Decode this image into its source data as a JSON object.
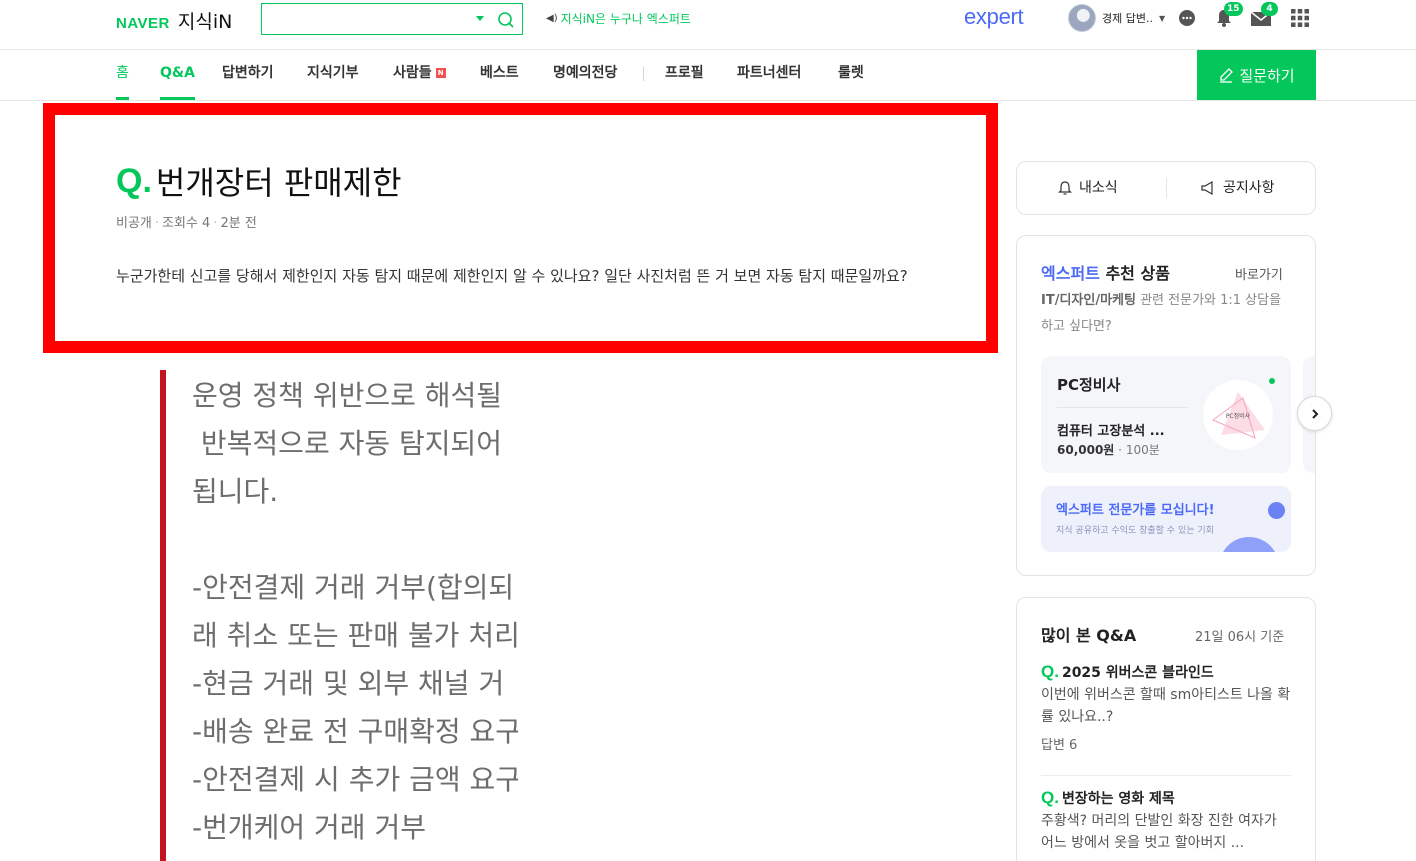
{
  "header": {
    "logo_naver": "NAVER",
    "logo_jisik": "지식iN",
    "search_value": "",
    "notice": "지식iN은 누구나 엑스퍼트",
    "expert_logo": "expert",
    "user_name": "경제 답변..",
    "notification_count": "15",
    "mail_count": "4"
  },
  "nav": {
    "items": [
      "홈",
      "Q&A",
      "답변하기",
      "지식기부",
      "사람들",
      "베스트",
      "명예의전당",
      "프로필",
      "파트너센터",
      "룰렛"
    ],
    "new_badge": "N",
    "ask_button": "질문하기"
  },
  "question": {
    "q_mark": "Q.",
    "title": "번개장터 판매제한",
    "author": "비공개",
    "views_label": "조회수 4",
    "time": "2분 전",
    "body": "누군가한테 신고를 당해서 제한인지 자동 탐지 때문에 제한인지 알 수 있나요? 일단 사진처럼 뜬 거 보면 자동 탐지 때문일까요?"
  },
  "attachment": {
    "lines": [
      "운영 정책 위반으로 해석될",
      " 반복적으로 자동 탐지되어",
      "됩니다.",
      "",
      "-안전결제 거래 거부(합의되",
      "래 취소 또는 판매 불가 처리",
      "-현금 거래 및 외부 채널 거",
      "-배송 완료 전 구매확정 요구",
      "-안전결제 시 추가 금액 요구",
      "-번개케어 거래 거부"
    ]
  },
  "sidebar": {
    "tab_news": "내소식",
    "tab_notice": "공지사항",
    "expert": {
      "head_blue": "엑스퍼트",
      "head_rest": " 추천 상품",
      "link": "바로가기",
      "sub_bold": "IT/디자인/마케팅",
      "sub_rest": " 관련 전문가와 1:1 상담을 하고 싶다면?",
      "product_title": "PC정비사",
      "product_name": "컴퓨터 고장분석 ...",
      "product_price": "60,000원",
      "product_time": "100분",
      "thumb_label": "PC정비사",
      "recruit_title": "엑스퍼트 전문가를 모십니다!",
      "recruit_sub": "지식 공유하고 수익도 창출할 수 있는 기회"
    },
    "popular": {
      "title": "많이 본 Q&A",
      "time": "21일 06시 기준",
      "items": [
        {
          "q": "2025 위버스콘 블라인드",
          "desc": "이번에 위버스콘 할때 sm아티스트 나올 확률 있나요..?",
          "answers": "답변 6"
        },
        {
          "q": "변장하는 영화 제목",
          "desc": "주황색? 머리의 단발인 화장 진한 여자가 어느 방에서 옷을 벗고 할아버지 ..."
        }
      ]
    }
  },
  "colors": {
    "naver_green": "#03c75a",
    "expert_blue": "#4c6af7",
    "highlight_red": "#ff0000"
  }
}
